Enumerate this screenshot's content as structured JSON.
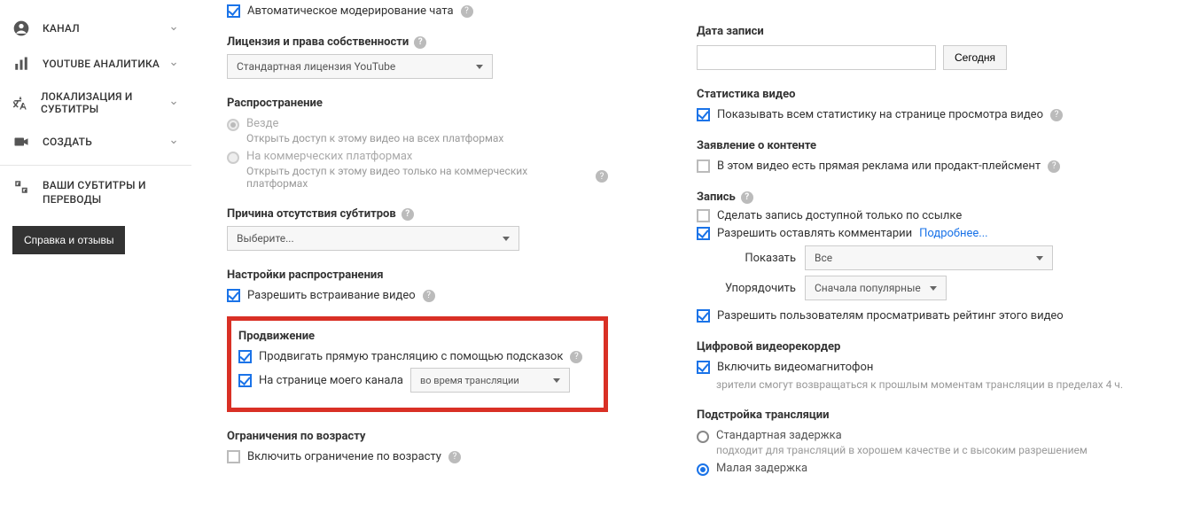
{
  "sidebar": {
    "items": [
      {
        "label": "КАНАЛ"
      },
      {
        "label": "YOUTUBE АНАЛИТИКА"
      },
      {
        "label": "ЛОКАЛИЗАЦИЯ И СУБТИТРЫ"
      },
      {
        "label": "СОЗДАТЬ"
      }
    ],
    "translations_label": "ВАШИ СУБТИТРЫ И ПЕРЕВОДЫ",
    "feedback_button": "Справка и отзывы"
  },
  "left_col": {
    "auto_moderation": "Автоматическое модерирование чата",
    "license_heading": "Лицензия и права собственности",
    "license_select": "Стандартная лицензия YouTube",
    "distribution_heading": "Распространение",
    "dist_everywhere": "Везде",
    "dist_everywhere_hint": "Открыть доступ к этому видео на всех платформах",
    "dist_commercial": "На коммерческих платформах",
    "dist_commercial_hint": "Открыть доступ к этому видео только на коммерческих платформах",
    "subs_reason_heading": "Причина отсутствия субтитров",
    "subs_reason_select": "Выберите...",
    "dist_settings_heading": "Настройки распространения",
    "allow_embed": "Разрешить встраивание видео",
    "promo_heading": "Продвижение",
    "promo_tips": "Продвигать прямую трансляцию с помощью подсказок",
    "promo_channel": "На странице моего канала",
    "promo_select": "во время трансляции",
    "age_heading": "Ограничения по возрасту",
    "age_enable": "Включить ограничение по возрасту"
  },
  "right_col": {
    "record_date_heading": "Дата записи",
    "today_button": "Сегодня",
    "stats_heading": "Статистика видео",
    "stats_show": "Показывать всем статистику на странице просмотра видео",
    "content_decl_heading": "Заявление о контенте",
    "content_decl_cb": "В этом видео есть прямая реклама или продакт-плейсмент",
    "recording_heading": "Запись",
    "rec_link_only": "Сделать запись доступной только по ссылке",
    "rec_allow_comments": "Разрешить оставлять комментарии",
    "rec_learn_more": "Подробнее...",
    "show_label": "Показать",
    "show_select": "Все",
    "sort_label": "Упорядочить",
    "sort_select": "Сначала популярные",
    "allow_rating": "Разрешить пользователям просматривать рейтинг этого видео",
    "dvr_heading": "Цифровой видеорекордер",
    "dvr_enable": "Включить видеомагнитофон",
    "dvr_hint": "зрители смогут возвращаться к прошлым моментам трансляции в пределах 4 ч.",
    "latency_heading": "Подстройка трансляции",
    "latency_std": "Стандартная задержка",
    "latency_std_hint": "подходит для трансляций в хорошем качестве и с высоким разрешением",
    "latency_low": "Малая задержка"
  }
}
